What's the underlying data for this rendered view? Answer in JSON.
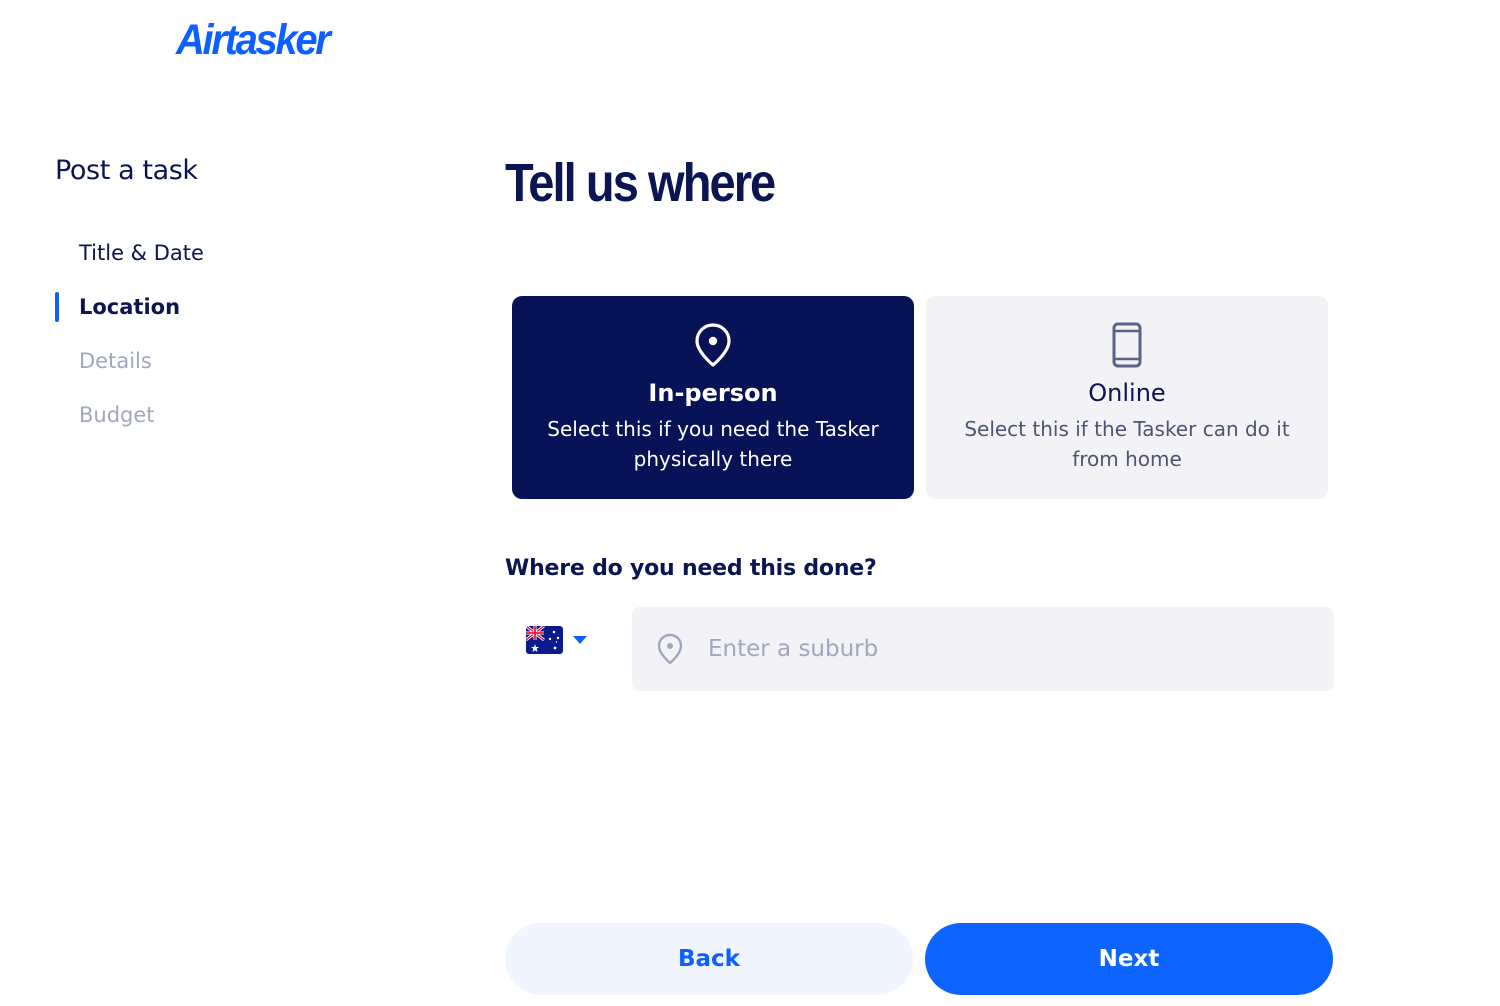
{
  "brand": {
    "logo_text": "Airtasker",
    "color": "#0d5fff"
  },
  "sidebar": {
    "title": "Post a task",
    "steps": [
      {
        "label": "Title & Date",
        "state": "done"
      },
      {
        "label": "Location",
        "state": "active"
      },
      {
        "label": "Details",
        "state": "todo"
      },
      {
        "label": "Budget",
        "state": "todo"
      }
    ]
  },
  "main": {
    "title": "Tell us where",
    "options": [
      {
        "icon": "map-pin-icon",
        "title": "In-person",
        "description": "Select this if you need the Tasker physically there",
        "selected": true
      },
      {
        "icon": "smartphone-icon",
        "title": "Online",
        "description": "Select this if the Tasker can do it from home",
        "selected": false
      }
    ],
    "location_question": "Where do you need this done?",
    "country_selector": {
      "icon": "australia-flag-icon",
      "caret_icon": "caret-down-icon"
    },
    "suburb_input": {
      "placeholder": "Enter a suburb",
      "value": "",
      "icon": "map-pin-icon"
    }
  },
  "footer": {
    "back_label": "Back",
    "next_label": "Next"
  },
  "colors": {
    "navy": "#071356",
    "accent": "#0d5fff",
    "muted": "#a0a7bf",
    "field_bg": "#f2f2f7"
  }
}
